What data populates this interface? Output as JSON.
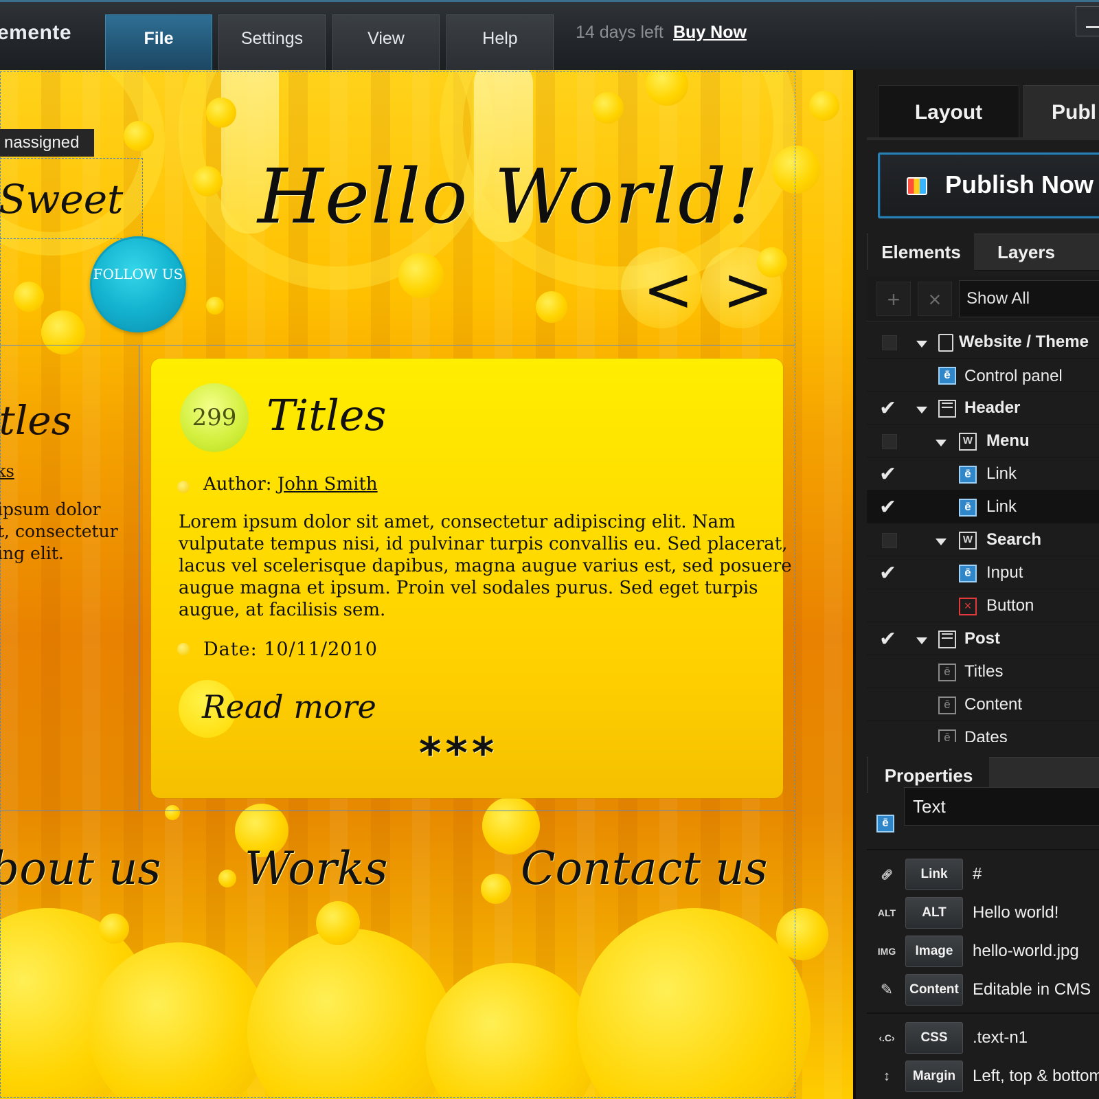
{
  "app": {
    "brand": "emente",
    "menu": [
      "File",
      "Settings",
      "View",
      "Help"
    ],
    "trial_text": "14 days left",
    "buy_now": "Buy Now"
  },
  "canvas": {
    "unassigned_label": "nassigned",
    "logo_text": "Sweet",
    "follow_button": "FOLLOW US",
    "headline": "Hello World!",
    "prev_arrow": "<",
    "next_arrow": ">",
    "left_column": {
      "title": "itles",
      "link": "ks",
      "text": "ipsum dolor\nt, consectetur\ning elit."
    },
    "post": {
      "count": "299",
      "title": "Titles",
      "author_label": "Author:",
      "author_name": "John Smith",
      "body": "Lorem ipsum dolor sit amet, consectetur adipiscing elit. Nam\nvulputate tempus nisi, id pulvinar turpis convallis eu. Sed placerat,\nlacus vel scelerisque dapibus, magna augue varius est, sed posuere\naugue magna et ipsum. Proin vel sodales purus. Sed eget turpis\naugue, at facilisis sem.",
      "date": "Date: 10/11/2010",
      "read_more": "Read more",
      "separator": "***"
    },
    "footer_nav": [
      "bout us",
      "Works",
      "Contact us"
    ]
  },
  "panel": {
    "tabs": [
      "Layout",
      "Publ"
    ],
    "publish_button": "Publish Now",
    "section_tabs": [
      "Elements",
      "Layers"
    ],
    "filter": "Show All",
    "tree": [
      {
        "label": "Website / Theme",
        "checked": false,
        "bold": true,
        "icon": "page-icon"
      },
      {
        "label": "Control panel",
        "checked": null,
        "bold": false,
        "icon": "element-icon"
      },
      {
        "label": "Header",
        "checked": true,
        "bold": true,
        "icon": "frame-icon"
      },
      {
        "label": "Menu",
        "checked": false,
        "bold": true,
        "icon": "widget-icon"
      },
      {
        "label": "Link",
        "checked": true,
        "bold": false,
        "icon": "element-icon"
      },
      {
        "label": "Link",
        "checked": true,
        "bold": false,
        "icon": "element-icon"
      },
      {
        "label": "Search",
        "checked": false,
        "bold": true,
        "icon": "widget-icon"
      },
      {
        "label": "Input",
        "checked": true,
        "bold": false,
        "icon": "element-icon"
      },
      {
        "label": "Button",
        "checked": null,
        "bold": false,
        "icon": "error-icon"
      },
      {
        "label": "Post",
        "checked": true,
        "bold": true,
        "icon": "frame-icon"
      },
      {
        "label": "Titles",
        "checked": null,
        "bold": false,
        "icon": "element-outline-icon"
      },
      {
        "label": "Content",
        "checked": null,
        "bold": false,
        "icon": "element-outline-icon"
      },
      {
        "label": "Dates",
        "checked": null,
        "bold": false,
        "icon": "element-outline-icon"
      }
    ],
    "properties_title": "Properties",
    "element_type": "Text",
    "props": [
      {
        "icon": "link-icon",
        "label": "Link",
        "value": "#"
      },
      {
        "icon": "alt-icon",
        "label": "ALT",
        "value": "Hello world!"
      },
      {
        "icon": "image-icon",
        "label": "Image",
        "value": "hello-world.jpg"
      },
      {
        "icon": "pencil-icon",
        "label": "Content",
        "value": "Editable in CMS"
      },
      {
        "icon": "css-icon",
        "label": "CSS",
        "value": ".text-n1"
      },
      {
        "icon": "margin-icon",
        "label": "Margin",
        "value": "Left, top & bottom"
      }
    ],
    "icon_glyphs": {
      "alt": "ALT",
      "image": "IMG",
      "css": "‹.C›",
      "margin": "↕"
    }
  },
  "colors": {
    "accent_blue": "#2a7fb5",
    "canvas_yellow": "#ffd21a",
    "canvas_orange": "#e98200",
    "follow_cyan": "#14b4d0",
    "panel_bg": "#1c1c1c"
  }
}
